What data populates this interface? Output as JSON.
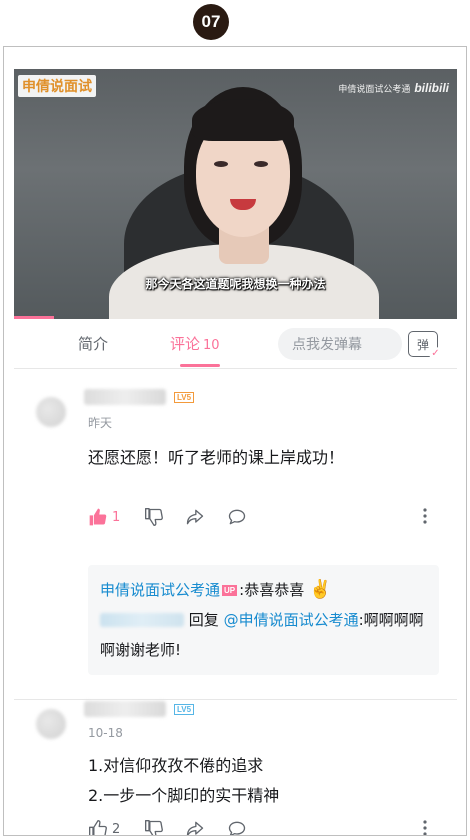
{
  "step_badge": "07",
  "video": {
    "watermark_left": "申倩说面试",
    "watermark_right_text": "申倩说面试公考通",
    "watermark_right_logo": "bilibili",
    "subtitle": "那今天各这道题呢我想换一种办法",
    "progress_fraction": 0.09
  },
  "tabs": {
    "intro": "简介",
    "comments": "评论",
    "comments_count": "10",
    "danmaku_placeholder": "点我发弹幕",
    "danmaku_toggle": "弹"
  },
  "comments": [
    {
      "level": "LV5",
      "time": "昨天",
      "content": "还愿还愿！听了老师的课上岸成功！",
      "likes": "1",
      "liked": true,
      "reply": {
        "up_name": "申倩说面试公考通",
        "up_badge": "UP",
        "up_text": "恭喜恭喜",
        "up_emoji": "✌️",
        "reply_word": "回复",
        "mention": "@申倩说面试公考通",
        "reply_text": ":啊啊啊啊啊谢谢老师!"
      }
    },
    {
      "level": "LV5",
      "time": "10-18",
      "content_lines": [
        "1.对信仰孜孜不倦的追求",
        "2.一步一个脚印的实干精神"
      ],
      "likes": "2",
      "liked": false
    }
  ],
  "icons": {
    "like": "thumbs-up-icon",
    "dislike": "thumbs-down-icon",
    "share": "share-icon",
    "reply": "comment-icon",
    "more": "more-vertical-icon"
  },
  "colors": {
    "accent": "#fb7299",
    "link": "#178bcf",
    "level_orange": "#f39a3b",
    "level_blue": "#56b6e6"
  }
}
